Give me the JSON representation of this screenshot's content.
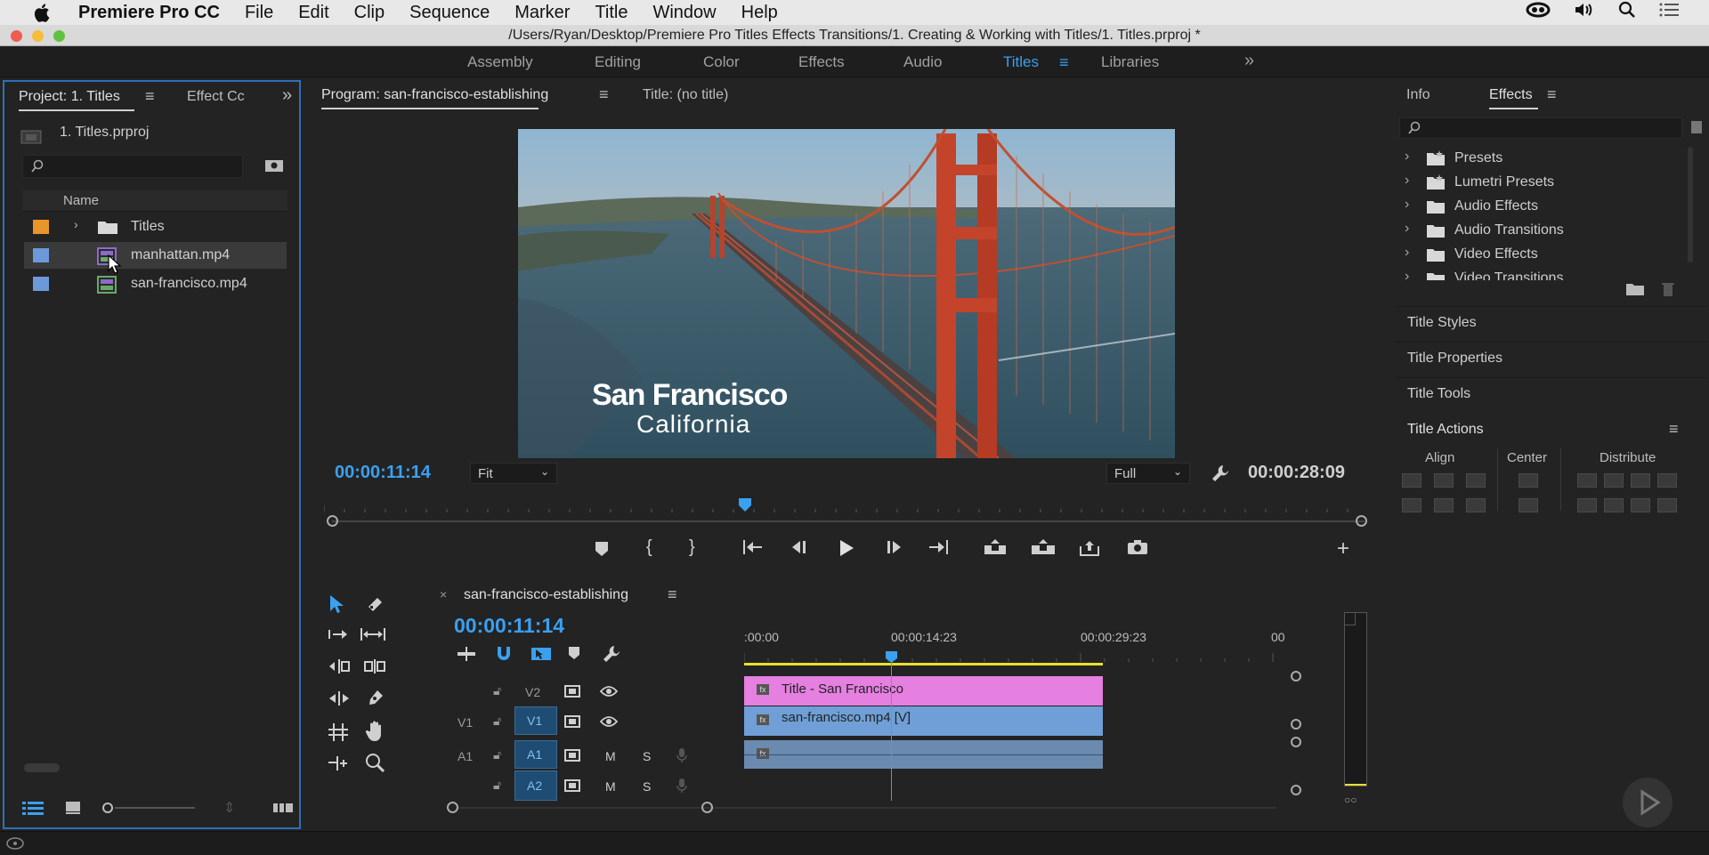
{
  "menubar": {
    "apple": "",
    "app": "Premiere Pro CC",
    "items": [
      "File",
      "Edit",
      "Clip",
      "Sequence",
      "Marker",
      "Title",
      "Window",
      "Help"
    ]
  },
  "window_title": "/Users/Ryan/Desktop/Premiere Pro Titles Effects Transitions/1. Creating & Working with Titles/1. Titles.prproj *",
  "workspaces": [
    "Assembly",
    "Editing",
    "Color",
    "Effects",
    "Audio",
    "Titles",
    "Libraries"
  ],
  "active_workspace": "Titles",
  "project": {
    "tab": "Project: 1. Titles",
    "tab2": "Effect Cc",
    "file": "1. Titles.prproj",
    "search_placeholder": "",
    "col_name": "Name",
    "items": [
      {
        "name": "Titles",
        "color": "#e8952b"
      },
      {
        "name": "manhattan.mp4",
        "color": "#6c9ad8"
      },
      {
        "name": "san-francisco.mp4",
        "color": "#6c9ad8"
      }
    ]
  },
  "program": {
    "tab": "Program: san-francisco-establishing",
    "tab2": "Title: (no title)",
    "video_title": "San Francisco",
    "video_subtitle": "California",
    "timecode": "00:00:11:14",
    "fit": "Fit",
    "full": "Full",
    "duration": "00:00:28:09"
  },
  "timeline": {
    "tab": "san-francisco-establishing",
    "timecode": "00:00:11:14",
    "ruler": [
      ":00:00",
      "00:00:14:23",
      "00:00:29:23",
      "00"
    ],
    "tracks": [
      {
        "src": "",
        "name": "V2"
      },
      {
        "src": "V1",
        "name": "V1"
      },
      {
        "src": "A1",
        "name": "A1"
      },
      {
        "src": "",
        "name": "A2"
      }
    ],
    "clip_title": "Title - San Francisco",
    "clip_video": "san-francisco.mp4 [V]",
    "m": "M",
    "s": "S"
  },
  "effects": {
    "tab_info": "Info",
    "tab_effects": "Effects",
    "items": [
      "Presets",
      "Lumetri Presets",
      "Audio Effects",
      "Audio Transitions",
      "Video Effects",
      "Video Transitions"
    ]
  },
  "title_panels": {
    "styles": "Title Styles",
    "properties": "Title Properties",
    "tools": "Title Tools",
    "actions": "Title Actions",
    "align": "Align",
    "center": "Center",
    "distribute": "Distribute"
  }
}
